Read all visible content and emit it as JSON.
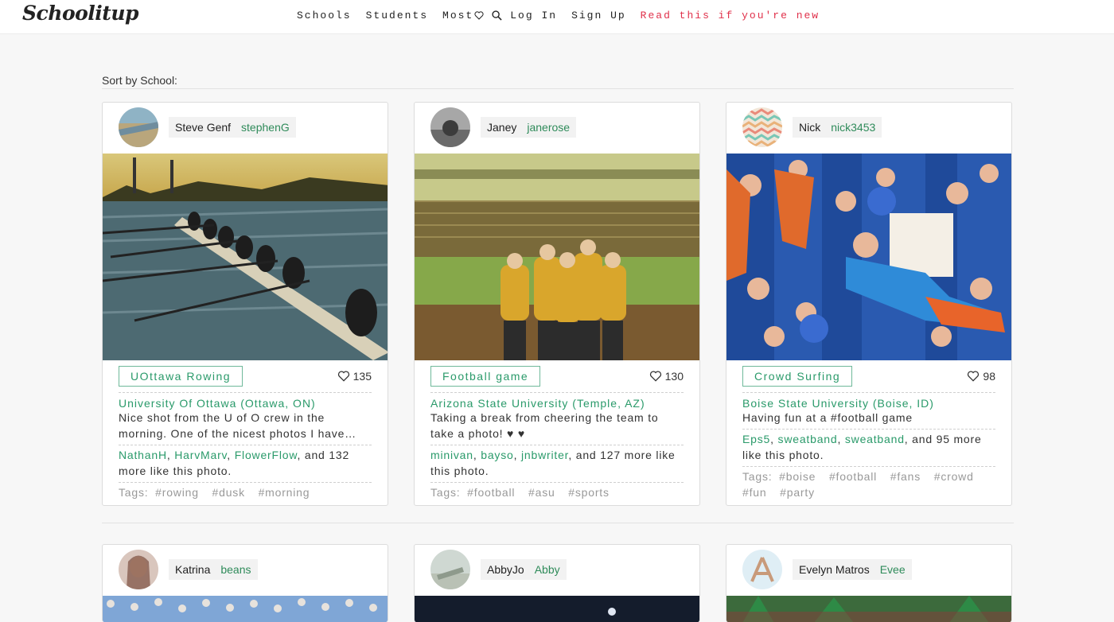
{
  "header": {
    "logo": "Schoolitup",
    "nav": {
      "schools": "Schools",
      "students": "Students",
      "most": "Most",
      "login": "Log In",
      "signup": "Sign Up",
      "new": "Read this if you're new"
    }
  },
  "section": {
    "title": "Sort by School:"
  },
  "cards": [
    {
      "display_name": "Steve Genf",
      "username": "stephenG",
      "caption": "UOttawa Rowing",
      "likes": "135",
      "school": "University Of Ottawa (Ottawa, ON)",
      "description": "Nice shot from the U of O crew in the morning. One of the nicest photos I have seen all year.",
      "likers": [
        "NathanH",
        "HarvMarv",
        "FlowerFlow"
      ],
      "likers_sep": ",",
      "likers_more": ", and 132 more like this photo.",
      "tags_label": "Tags:",
      "tags": [
        "#rowing",
        "#dusk",
        "#morning"
      ]
    },
    {
      "display_name": "Janey",
      "username": "janerose",
      "caption": "Football game",
      "likes": "130",
      "school": "Arizona State University (Temple, AZ)",
      "description": "Taking a break from cheering the team to take a photo! ♥ ♥",
      "likers": [
        "minivan",
        "bayso",
        "jnbwriter"
      ],
      "likers_sep": ",",
      "likers_more": ", and 127 more like this photo.",
      "tags_label": "Tags:",
      "tags": [
        "#football",
        "#asu",
        "#sports"
      ]
    },
    {
      "display_name": "Nick",
      "username": "nick3453",
      "caption": "Crowd Surfing",
      "likes": "98",
      "school": "Boise State University (Boise, ID)",
      "description": "Having fun at a #football game",
      "likers": [
        "Eps5",
        "sweatband",
        "sweatband"
      ],
      "likers_sep": ",",
      "likers_more": ", and 95 more like this photo.",
      "tags_label": "Tags:",
      "tags": [
        "#boise",
        "#football",
        "#fans",
        "#crowd",
        "#fun",
        "#party"
      ]
    },
    {
      "display_name": "Katrina",
      "username": "beans"
    },
    {
      "display_name": "AbbyJo",
      "username": "Abby"
    },
    {
      "display_name": "Evelyn Matros",
      "username": "Evee"
    }
  ],
  "colors": {
    "accent_green": "#2a9a6a",
    "new_link_red": "#e0304a",
    "username_green": "#2f8b5a"
  }
}
